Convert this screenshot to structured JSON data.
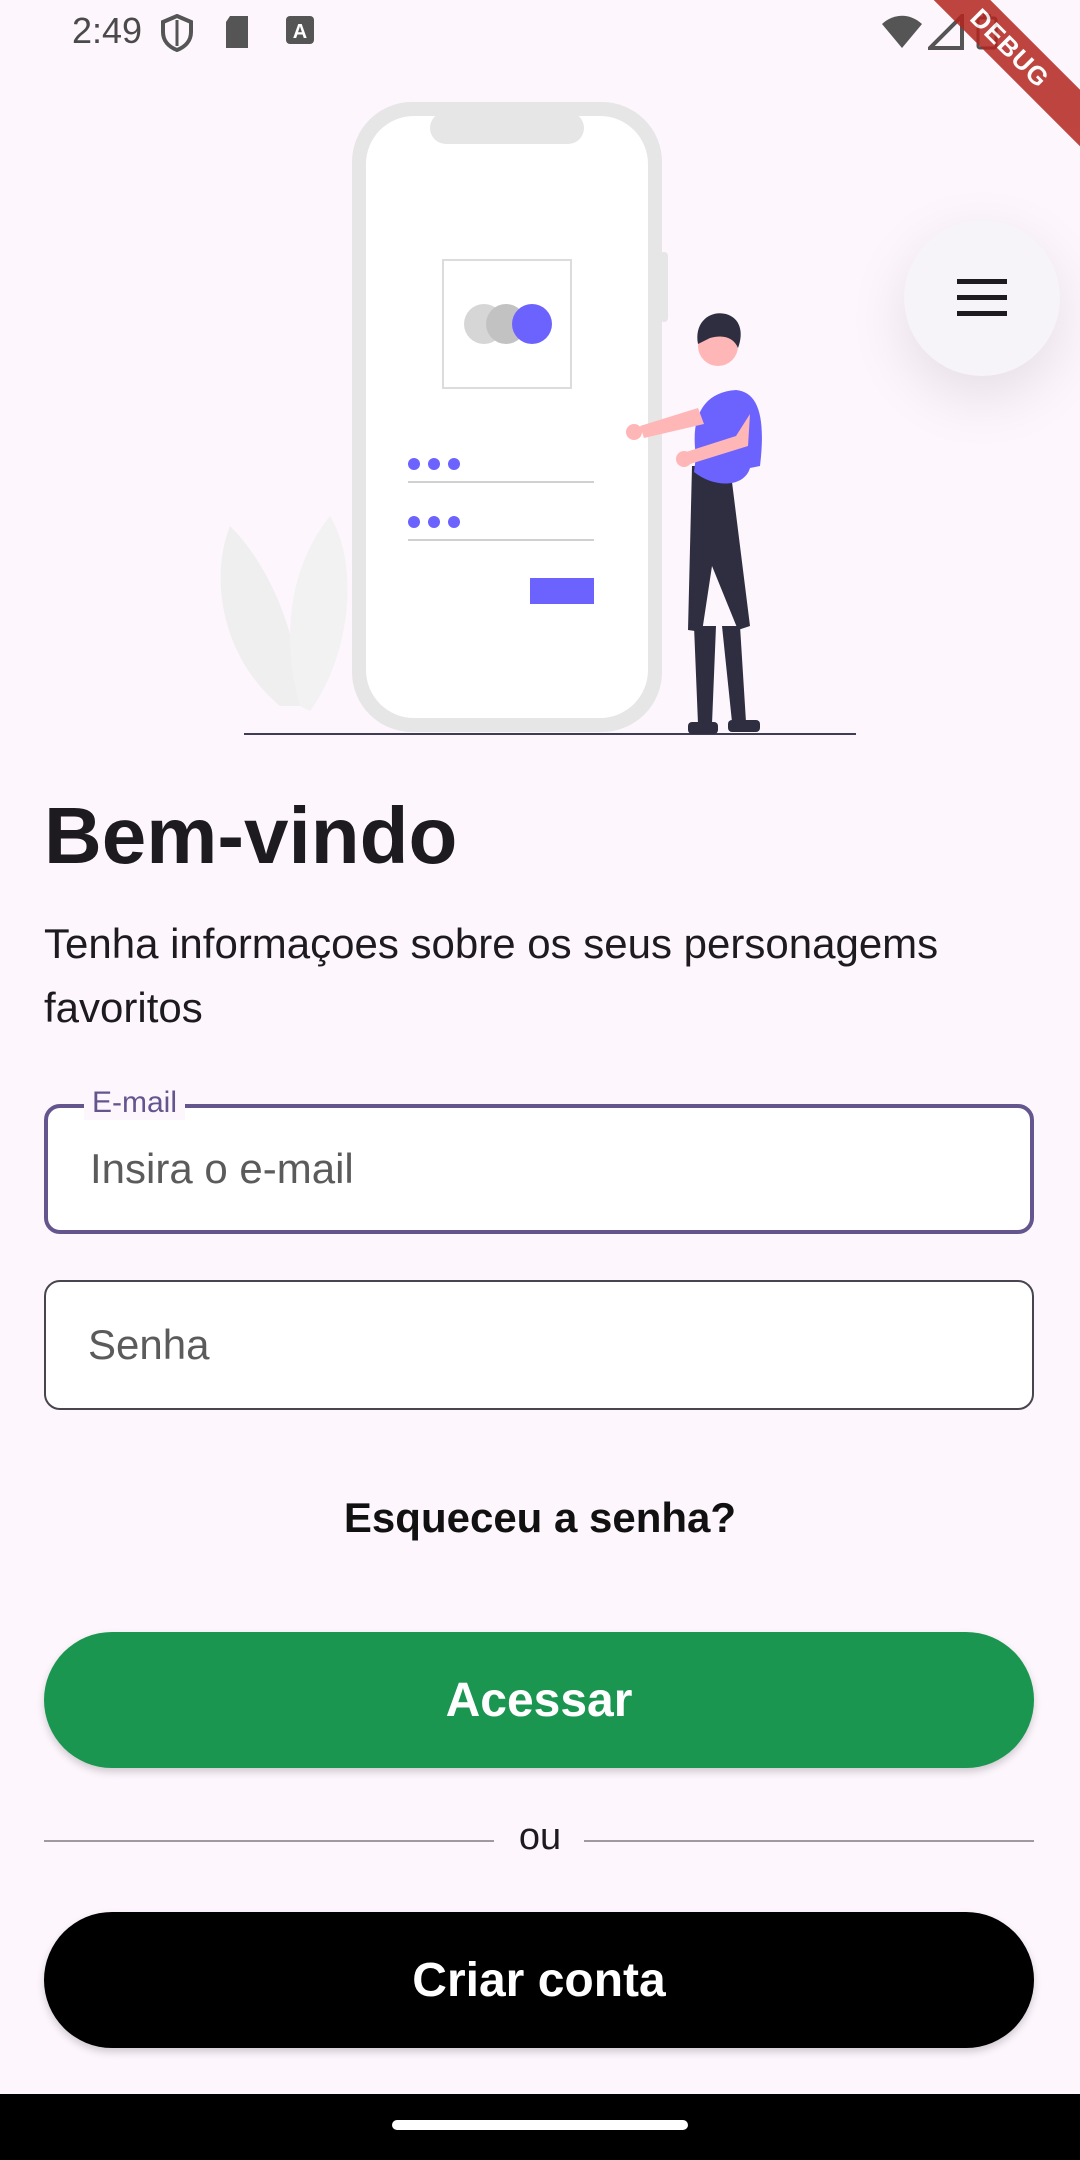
{
  "status_bar": {
    "time": "2:49",
    "debug_label": "DEBUG"
  },
  "icons": {
    "menu": "hamburger-menu-icon",
    "shield": "shield-icon",
    "sd_card": "sd-card-icon",
    "keyboard": "keyboard-icon",
    "wifi": "wifi-icon",
    "signal": "signal-icon",
    "battery": "battery-icon"
  },
  "login": {
    "title": "Bem-vindo",
    "subtitle": "Tenha informaçoes sobre os seus personagems favoritos",
    "email_label": "E-mail",
    "email_placeholder": "Insira o e-mail",
    "password_placeholder": "Senha",
    "forgot_password": "Esqueceu a senha?",
    "access_button": "Acessar",
    "divider": "ou",
    "create_account_button": "Criar conta"
  },
  "colors": {
    "background": "#fdf6fd",
    "accent": "#65558f",
    "primary_button": "#1a9650",
    "secondary_button": "#000000",
    "illustration_accent": "#6c63ff"
  }
}
